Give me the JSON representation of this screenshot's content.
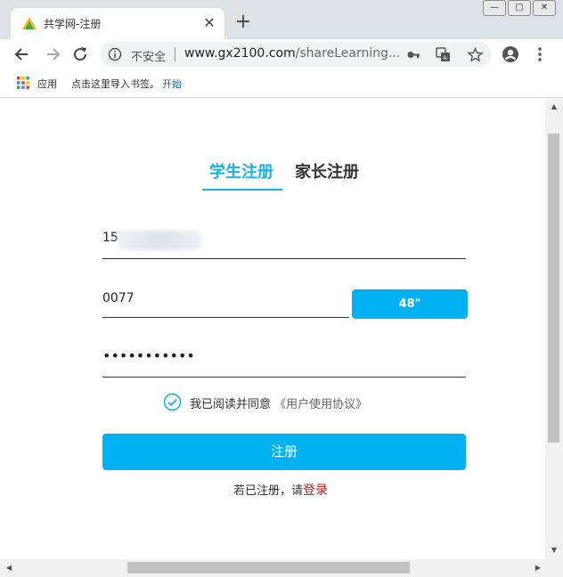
{
  "browser": {
    "tab_title": "共学网-注册",
    "tab_close": "✕",
    "new_tab": "+",
    "window_controls": [
      "—",
      "▢",
      "✕"
    ],
    "insecure_label": "不安全",
    "url_host": "www.gx2100.com",
    "url_rest": "/shareLearning...",
    "icons": [
      "back-arrow-icon",
      "forward-arrow-icon",
      "reload-icon",
      "info-icon",
      "key-icon",
      "translate-icon",
      "star-icon",
      "profile-icon",
      "menu-icon",
      "apps-icon",
      "favicon-icon"
    ],
    "bookmarks": {
      "apps_label": "应用",
      "import_hint": "点击这里导入书签。",
      "start_link": "开始"
    }
  },
  "form": {
    "tabs": [
      {
        "label": "学生注册",
        "active": true
      },
      {
        "label": "家长注册",
        "active": false
      }
    ],
    "phone_value": "15",
    "code_value": "0077",
    "code_button": "48\"",
    "password_value": "•••••••••••",
    "agree_text": "我已阅读并同意",
    "agree_link": "《用户使用协议》",
    "submit_label": "注册",
    "login_prompt": "若已注册，请",
    "login_link": "登录"
  },
  "colors": {
    "accent": "#00b1f2",
    "tab_active": "#1ab0e8",
    "login_link": "#c8161d"
  }
}
